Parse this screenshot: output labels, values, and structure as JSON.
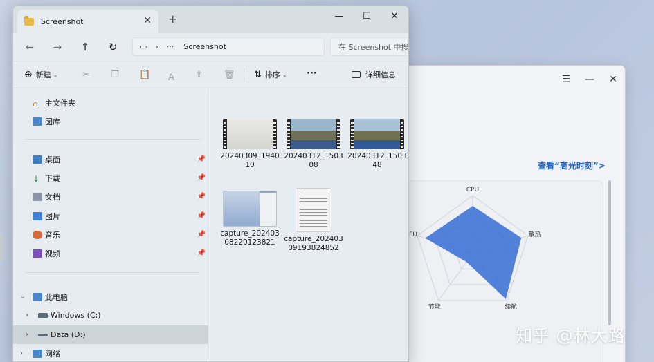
{
  "explorer": {
    "tab_title": "Screenshot",
    "close_glyph": "✕",
    "new_tab_glyph": "+",
    "window_controls": {
      "minimize": "—",
      "maximize": "☐",
      "close": "✕"
    },
    "nav": {
      "back": "←",
      "forward": "→",
      "up": "↑",
      "refresh": "↻"
    },
    "address": {
      "monitor_icon": "▭",
      "chevron": "›",
      "more": "···",
      "folder": "Screenshot"
    },
    "search_placeholder": "在 Screenshot 中搜索",
    "toolbar": {
      "new_label": "新建",
      "sort_label": "排序",
      "more": "···",
      "details_label": "详细信息"
    },
    "sidebar": {
      "quick": [
        {
          "label": "主文件夹",
          "icon": "home-icon"
        },
        {
          "label": "图库",
          "icon": "gallery-icon"
        }
      ],
      "pinned": [
        {
          "label": "桌面",
          "icon": "desktop-icon"
        },
        {
          "label": "下载",
          "icon": "download-icon"
        },
        {
          "label": "文档",
          "icon": "documents-icon"
        },
        {
          "label": "图片",
          "icon": "pictures-icon"
        },
        {
          "label": "音乐",
          "icon": "music-icon"
        },
        {
          "label": "视频",
          "icon": "videos-icon"
        }
      ],
      "pc": {
        "label": "此电脑",
        "icon": "pc-icon"
      },
      "drives": [
        {
          "label": "Windows (C:)",
          "icon": "drive-icon"
        },
        {
          "label": "Data (D:)",
          "icon": "drive-icon"
        }
      ],
      "network": {
        "label": "网络",
        "icon": "network-icon"
      },
      "pin_glyph": "📌"
    },
    "files": [
      {
        "name_line1": "20240309_1940",
        "name_line2": "10",
        "kind": "video"
      },
      {
        "name_line1": "20240312_1503",
        "name_line2": "08",
        "kind": "video"
      },
      {
        "name_line1": "20240312_1503",
        "name_line2": "48",
        "kind": "video"
      },
      {
        "name_line1": "capture_202403",
        "name_line2": "08220123821",
        "kind": "image"
      },
      {
        "name_line1": "capture_202403",
        "name_line2": "09193824852",
        "kind": "document"
      }
    ]
  },
  "background_app": {
    "controls": {
      "menu": "☰",
      "minimize": "—",
      "close": "✕"
    },
    "highlight_link": "查看“高光时刻”>",
    "radar": {
      "axes": [
        "CPU",
        "散热",
        "续航",
        "节能",
        "GPU"
      ],
      "values": [
        0.82,
        0.88,
        0.97,
        0.18,
        0.86
      ],
      "fill_color": "#3f74d6"
    }
  },
  "watermark": "知乎 @林大路"
}
